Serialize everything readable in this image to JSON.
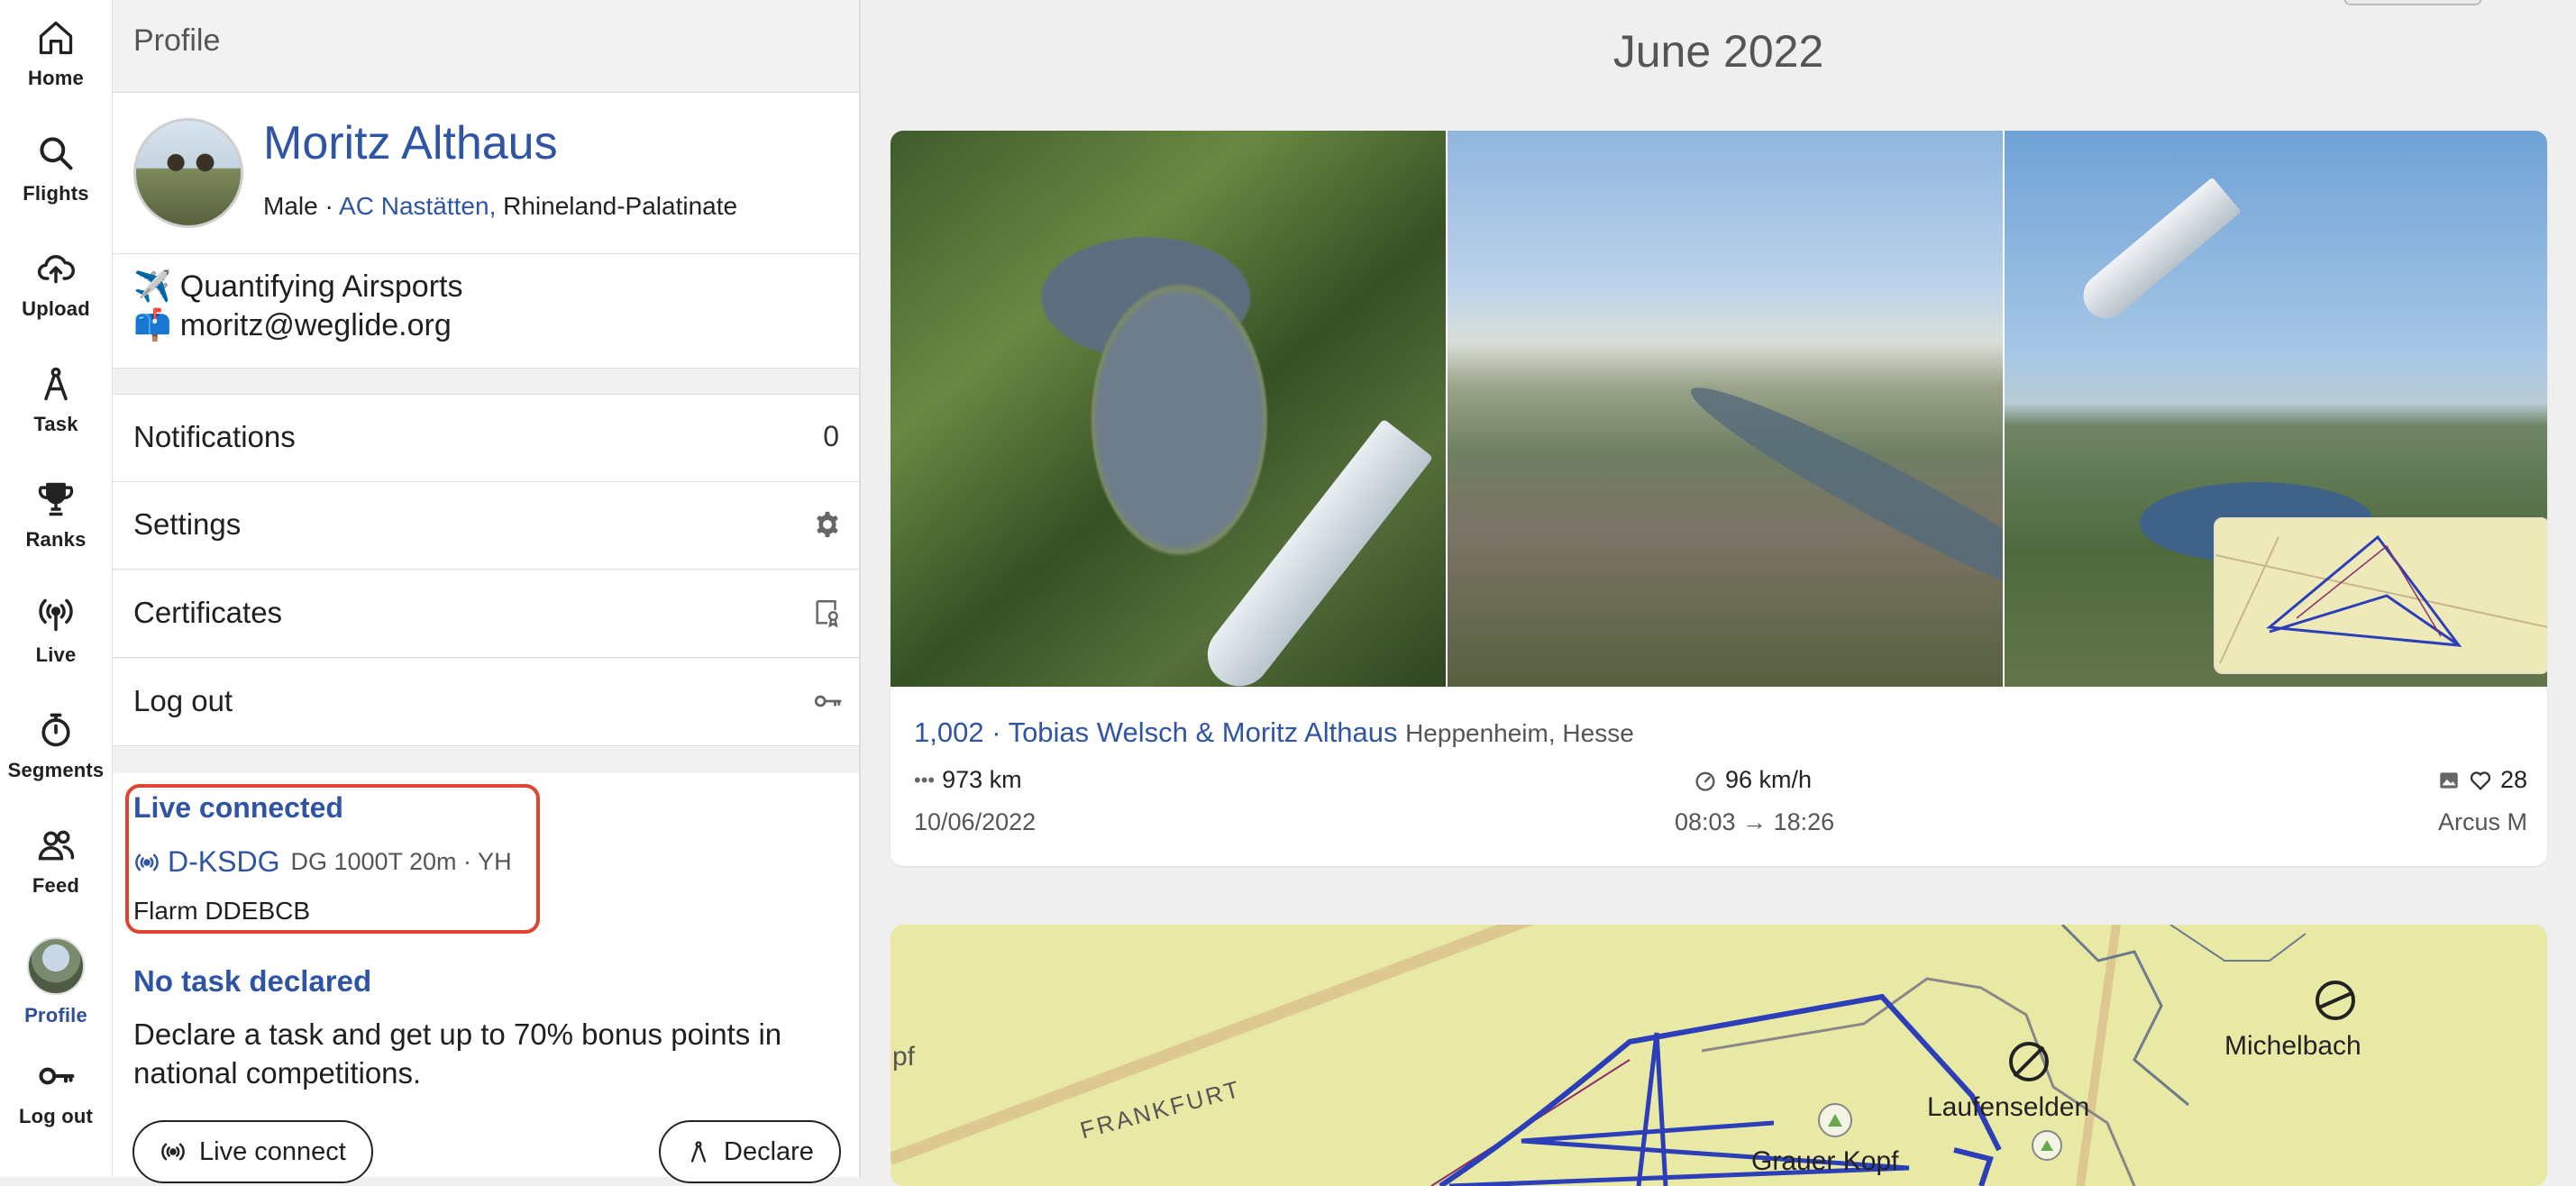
{
  "nav": {
    "items": [
      {
        "label": "Home",
        "icon": "home-icon"
      },
      {
        "label": "Flights",
        "icon": "search-icon"
      },
      {
        "label": "Upload",
        "icon": "cloud-upload-icon"
      },
      {
        "label": "Task",
        "icon": "compass-icon"
      },
      {
        "label": "Ranks",
        "icon": "trophy-icon"
      },
      {
        "label": "Live",
        "icon": "broadcast-icon"
      },
      {
        "label": "Segments",
        "icon": "stopwatch-icon"
      },
      {
        "label": "Feed",
        "icon": "people-icon"
      },
      {
        "label": "Profile",
        "icon": "avatar"
      },
      {
        "label": "Log out",
        "icon": "key-icon"
      }
    ],
    "active": "Profile"
  },
  "panel": {
    "header_title": "Profile",
    "profile": {
      "name": "Moritz Althaus",
      "gender": "Male",
      "separator": "·",
      "club": "AC Nastätten,",
      "region": "Rhineland-Palatinate"
    },
    "bio": {
      "line1": "✈️ Quantifying Airsports",
      "line2": "📫 moritz@weglide.org"
    },
    "menu": {
      "notifications_label": "Notifications",
      "notifications_count": "0",
      "settings_label": "Settings",
      "certificates_label": "Certificates",
      "logout_label": "Log out"
    },
    "live": {
      "title": "Live connected",
      "registration": "D-KSDG",
      "aircraft": "DG 1000T 20m · YH",
      "flarm": "Flarm DDEBCB"
    },
    "task": {
      "title": "No task declared",
      "text": "Declare a task and get up to 70% bonus points in national competitions."
    },
    "buttons": {
      "live_connect": "Live connect",
      "declare": "Declare"
    }
  },
  "feed": {
    "month": "June 2022",
    "flight": {
      "title": "1,002 · Tobias Welsch & Moritz Althaus",
      "location": "Heppenheim, Hesse",
      "distance": "973 km",
      "speed": "96 km/h",
      "likes": "28",
      "date": "10/06/2022",
      "time": "08:03 → 18:26",
      "aircraft": "Arcus M"
    },
    "map_labels": {
      "frankfurt": "FRANKFURT",
      "pf": "pf",
      "michelbach": "Michelbach",
      "laufenselden": "Laufenselden",
      "grauer_kopf": "Grauer Kopf"
    }
  },
  "colors": {
    "accent": "#2f54a4",
    "highlight": "#e0432f",
    "map_bg": "#e8e9a5",
    "track": "#2c3fb8"
  }
}
